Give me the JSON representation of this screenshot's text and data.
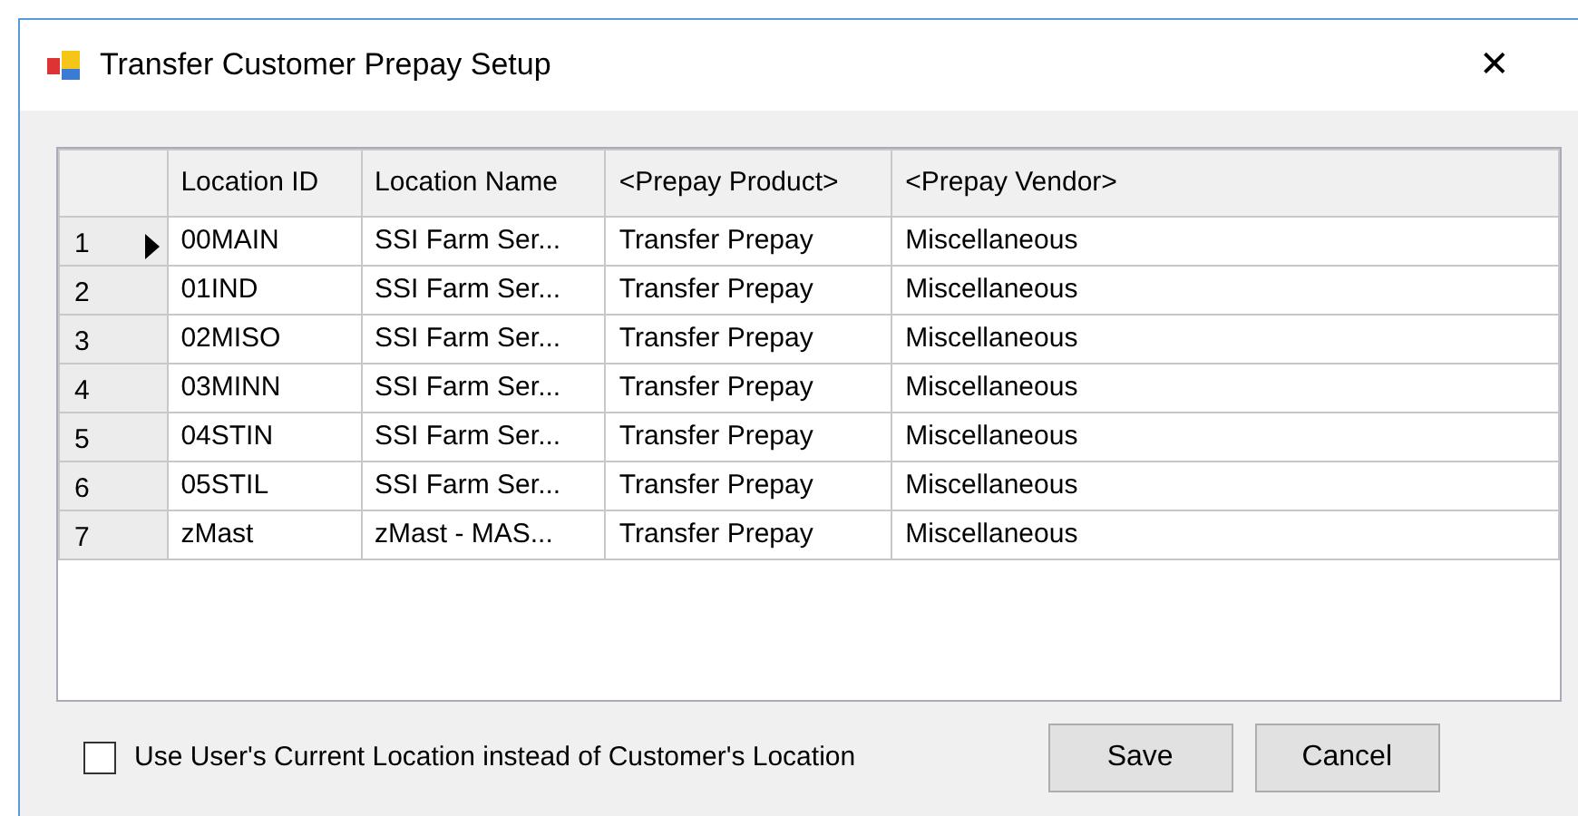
{
  "window": {
    "title": "Transfer Customer Prepay Setup",
    "close": "✕"
  },
  "table": {
    "columns": [
      "Location ID",
      "Location Name",
      "<Prepay Product>",
      "<Prepay Vendor>"
    ],
    "rows": [
      {
        "number": "1",
        "selected": true,
        "cells": [
          "00MAIN",
          "SSI Farm Ser...",
          "Transfer Prepay",
          "Miscellaneous"
        ]
      },
      {
        "number": "2",
        "selected": false,
        "cells": [
          "01IND",
          "SSI Farm Ser...",
          "Transfer Prepay",
          "Miscellaneous"
        ]
      },
      {
        "number": "3",
        "selected": false,
        "cells": [
          "02MISO",
          "SSI Farm Ser...",
          "Transfer Prepay",
          "Miscellaneous"
        ]
      },
      {
        "number": "4",
        "selected": false,
        "cells": [
          "03MINN",
          "SSI Farm Ser...",
          "Transfer Prepay",
          "Miscellaneous"
        ]
      },
      {
        "number": "5",
        "selected": false,
        "cells": [
          "04STIN",
          "SSI Farm Ser...",
          "Transfer Prepay",
          "Miscellaneous"
        ]
      },
      {
        "number": "6",
        "selected": false,
        "cells": [
          "05STIL",
          "SSI Farm Ser...",
          "Transfer Prepay",
          "Miscellaneous"
        ]
      },
      {
        "number": "7",
        "selected": false,
        "cells": [
          "zMast",
          "zMast - MAS...",
          "Transfer Prepay",
          "Miscellaneous"
        ]
      }
    ]
  },
  "option": {
    "label": "Use User's Current Location instead of Customer's Location",
    "checked": false
  },
  "buttons": [
    "Save",
    "Cancel"
  ]
}
